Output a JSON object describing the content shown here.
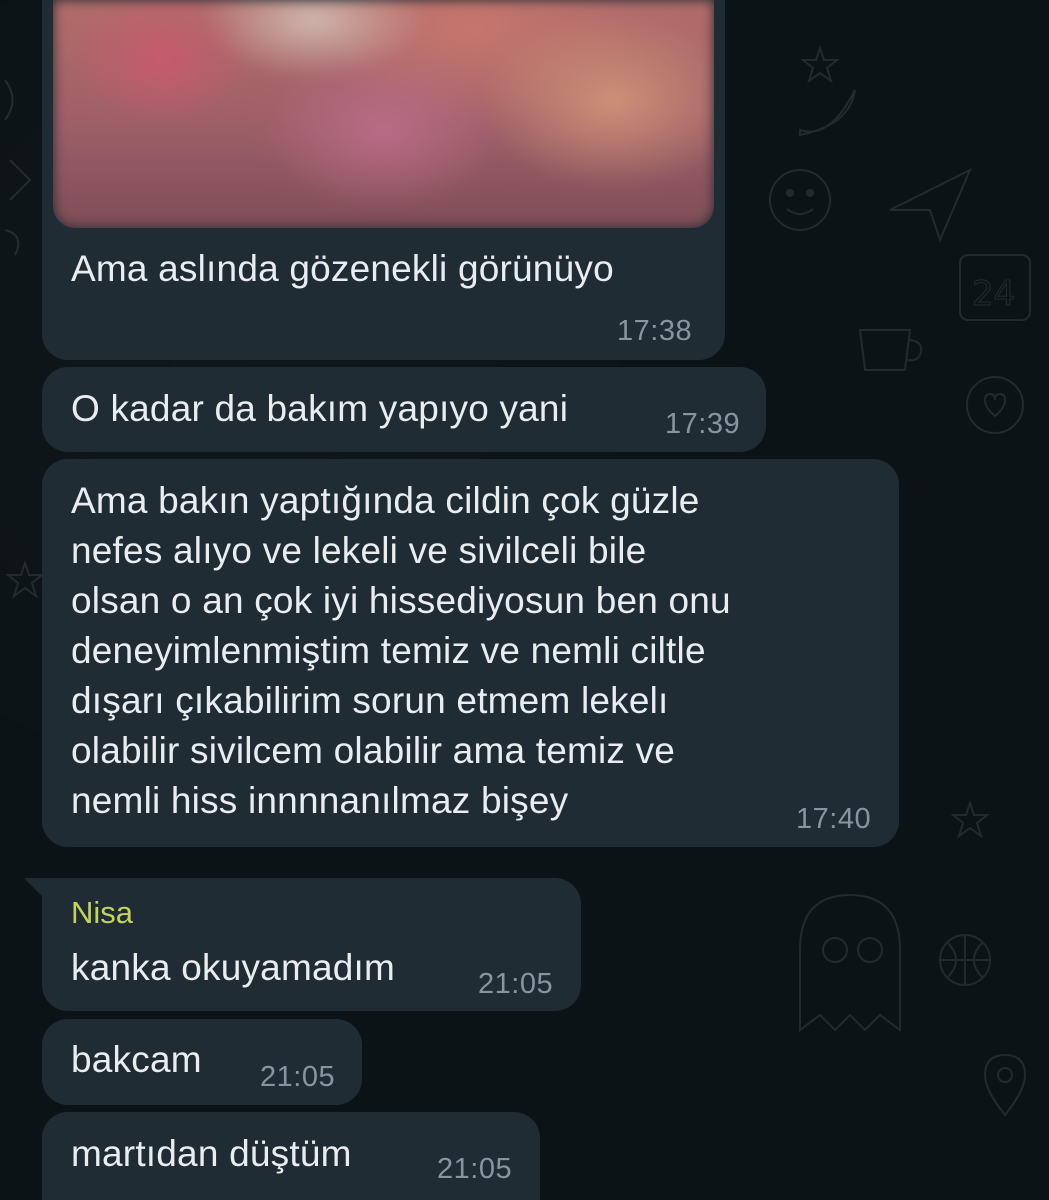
{
  "chat": {
    "messages": [
      {
        "text": "Ama aslında gözenekli görünüyo",
        "time": "17:38",
        "has_image": true
      },
      {
        "text": "O kadar da bakım yapıyo yani",
        "time": "17:39"
      },
      {
        "text": "Ama bakın yaptığında cildin çok güzle\nnefes alıyo ve lekeli ve sivilceli bile\nolsan o an çok iyi hissediyosun ben onu\ndeneyimlenmiştim temiz ve nemli ciltle\ndışarı çıkabilirim sorun etmem lekelı\nolabilir sivilcem olabilir ama temiz ve\nnemli hiss innnnanılmaz bişey",
        "time": "17:40"
      },
      {
        "sender": "Nisa",
        "text": "kanka okuyamadım",
        "time": "21:05"
      },
      {
        "text": "bakcam",
        "time": "21:05"
      },
      {
        "text": "martıdan düştüm",
        "time": "21:05"
      }
    ]
  },
  "colors": {
    "background": "#0c1317",
    "bubble": "#202c33",
    "text": "#e9edef",
    "time": "#8696a0",
    "sender_name": "#c6d35b"
  },
  "icons": [
    "doodle-star-icon",
    "doodle-heart-icon",
    "doodle-smiley-icon",
    "doodle-banana-icon",
    "doodle-airplane-icon",
    "doodle-calendar-icon",
    "doodle-cup-icon",
    "doodle-ghost-icon",
    "doodle-basketball-icon",
    "doodle-pin-icon"
  ]
}
